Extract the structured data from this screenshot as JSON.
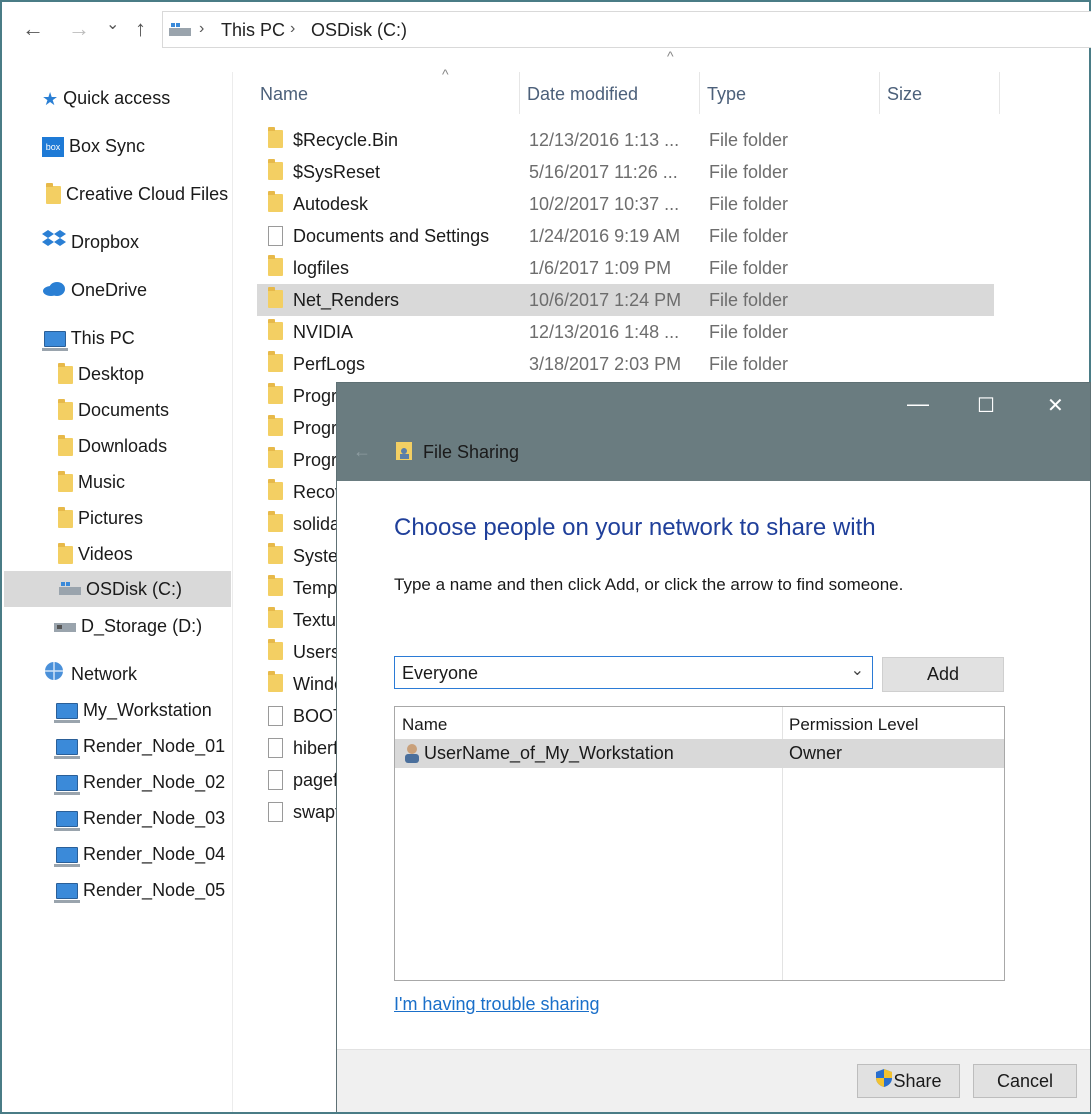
{
  "address": {
    "back_arrow": "←",
    "forward_arrow": "→",
    "recent_arrow": "⌄",
    "up_arrow": "↑",
    "crumbs": [
      "This PC",
      "OSDisk (C:)"
    ],
    "separator": "›"
  },
  "sidebar": {
    "items": [
      {
        "label": "Quick access",
        "icon": "star-icon"
      },
      {
        "label": "Box Sync",
        "icon": "box-icon"
      },
      {
        "label": "Creative Cloud Files",
        "icon": "creative-cloud-icon"
      },
      {
        "label": "Dropbox",
        "icon": "dropbox-icon"
      },
      {
        "label": "OneDrive",
        "icon": "cloud-icon"
      },
      {
        "label": "This PC",
        "icon": "computer-icon"
      },
      {
        "label": "Desktop",
        "icon": "folder-icon"
      },
      {
        "label": "Documents",
        "icon": "folder-icon"
      },
      {
        "label": "Downloads",
        "icon": "folder-icon"
      },
      {
        "label": "Music",
        "icon": "folder-icon"
      },
      {
        "label": "Pictures",
        "icon": "folder-icon"
      },
      {
        "label": "Videos",
        "icon": "folder-icon"
      },
      {
        "label": "OSDisk (C:)",
        "icon": "drive-icon",
        "selected": true
      },
      {
        "label": "D_Storage (D:)",
        "icon": "drive-icon"
      },
      {
        "label": "Network",
        "icon": "network-icon"
      },
      {
        "label": "My_Workstation",
        "icon": "computer-icon"
      },
      {
        "label": "Render_Node_01",
        "icon": "computer-icon"
      },
      {
        "label": "Render_Node_02",
        "icon": "computer-icon"
      },
      {
        "label": "Render_Node_03",
        "icon": "computer-icon"
      },
      {
        "label": "Render_Node_04",
        "icon": "computer-icon"
      },
      {
        "label": "Render_Node_05",
        "icon": "computer-icon"
      }
    ]
  },
  "columns": {
    "name": "Name",
    "date": "Date modified",
    "type": "Type",
    "size": "Size",
    "sort_glyph": "^"
  },
  "files": [
    {
      "name": "$Recycle.Bin",
      "date": "12/13/2016 1:13 ...",
      "type": "File folder",
      "kind": "folder"
    },
    {
      "name": "$SysReset",
      "date": "5/16/2017 11:26 ...",
      "type": "File folder",
      "kind": "folder"
    },
    {
      "name": "Autodesk",
      "date": "10/2/2017 10:37 ...",
      "type": "File folder",
      "kind": "folder"
    },
    {
      "name": "Documents and Settings",
      "date": "1/24/2016 9:19 AM",
      "type": "File folder",
      "kind": "shortcut"
    },
    {
      "name": "logfiles",
      "date": "1/6/2017 1:09 PM",
      "type": "File folder",
      "kind": "folder"
    },
    {
      "name": "Net_Renders",
      "date": "10/6/2017 1:24 PM",
      "type": "File folder",
      "kind": "folder",
      "selected": true
    },
    {
      "name": "NVIDIA",
      "date": "12/13/2016 1:48 ...",
      "type": "File folder",
      "kind": "folder"
    },
    {
      "name": "PerfLogs",
      "date": "3/18/2017 2:03 PM",
      "type": "File folder",
      "kind": "folder"
    },
    {
      "name": "Progr",
      "date": "",
      "type": "",
      "kind": "folder"
    },
    {
      "name": "Progr",
      "date": "",
      "type": "",
      "kind": "folder"
    },
    {
      "name": "Progr",
      "date": "",
      "type": "",
      "kind": "folder"
    },
    {
      "name": "Recov",
      "date": "",
      "type": "",
      "kind": "folder"
    },
    {
      "name": "solida",
      "date": "",
      "type": "",
      "kind": "folder"
    },
    {
      "name": "Syster",
      "date": "",
      "type": "",
      "kind": "folder"
    },
    {
      "name": "Temp",
      "date": "",
      "type": "",
      "kind": "folder"
    },
    {
      "name": "Textur",
      "date": "",
      "type": "",
      "kind": "folder"
    },
    {
      "name": "Users",
      "date": "",
      "type": "",
      "kind": "folder"
    },
    {
      "name": "Windo",
      "date": "",
      "type": "",
      "kind": "folder"
    },
    {
      "name": "BOOT",
      "date": "",
      "type": "",
      "kind": "file"
    },
    {
      "name": "hiberf",
      "date": "",
      "type": "",
      "kind": "file"
    },
    {
      "name": "pagef",
      "date": "",
      "type": "",
      "kind": "file"
    },
    {
      "name": "swapf",
      "date": "",
      "type": "",
      "kind": "file"
    }
  ],
  "dialog": {
    "title": "File Sharing",
    "back_arrow": "←",
    "minimize": "—",
    "maximize": "☐",
    "close": "✕",
    "heading": "Choose people on your network to share with",
    "instructions": "Type a name and then click Add, or click the arrow to find someone.",
    "name_input": "Everyone",
    "dropdown_arrow": "⌄",
    "add_label": "Add",
    "list_headers": {
      "name": "Name",
      "permission": "Permission Level"
    },
    "entries": [
      {
        "name": "UserName_of_My_Workstation",
        "permission": "Owner"
      }
    ],
    "trouble_link": "I'm having trouble sharing",
    "share_label": "Share",
    "cancel_label": "Cancel"
  },
  "colors": {
    "accent_blue": "#1f3f9a",
    "link_blue": "#1a6fc9",
    "dialog_titlebar": "#6a7c80",
    "selection_gray": "#d9d9d9",
    "window_border": "#4a7c86"
  }
}
